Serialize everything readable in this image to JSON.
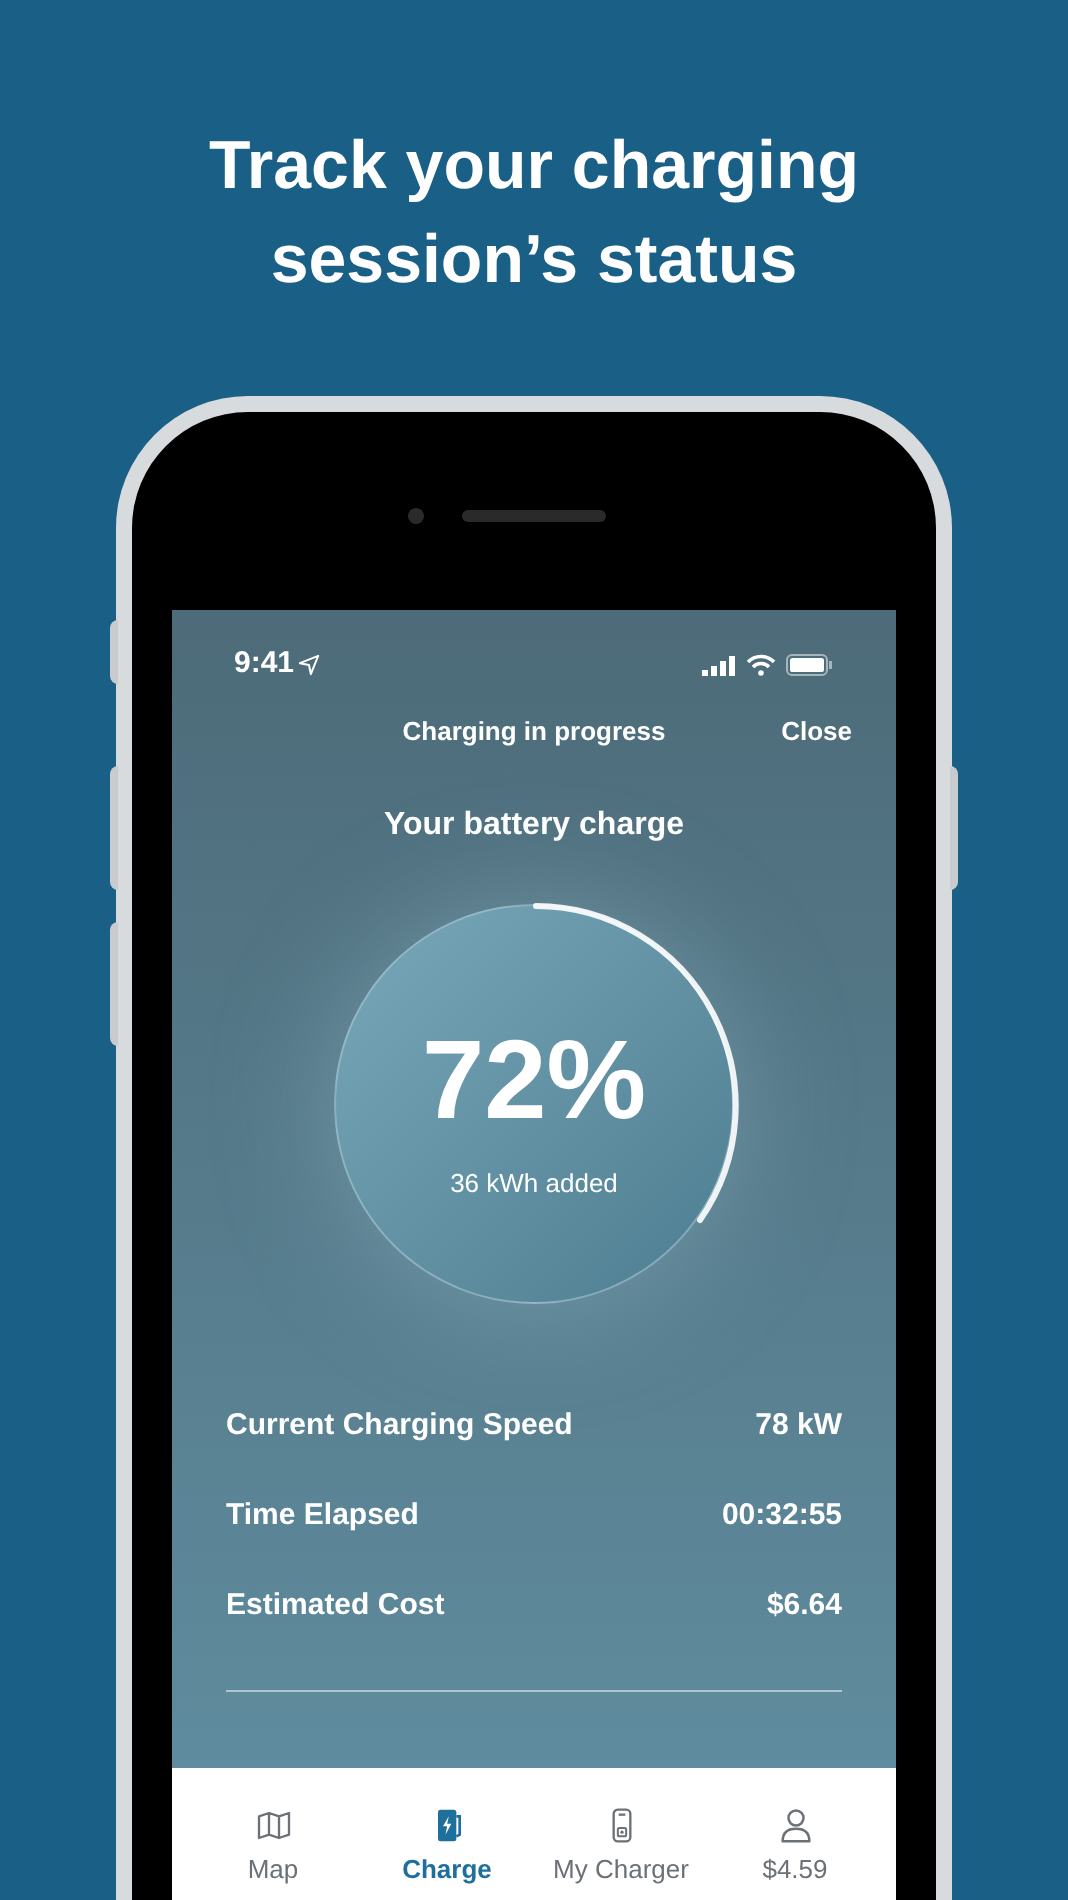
{
  "headline": "Track your charging session’s status",
  "status_bar": {
    "time": "9:41"
  },
  "header": {
    "title": "Charging in progress",
    "close": "Close"
  },
  "battery": {
    "heading": "Your battery charge",
    "percent": "72%",
    "added": "36 kWh added"
  },
  "stats": [
    {
      "label": "Current Charging Speed",
      "value": "78 kW"
    },
    {
      "label": "Time Elapsed",
      "value": "00:32:55"
    },
    {
      "label": "Estimated Cost",
      "value": "$6.64"
    }
  ],
  "tab_bar": [
    {
      "label": "Map",
      "selected": false
    },
    {
      "label": "Charge",
      "selected": true
    },
    {
      "label": "My Charger",
      "selected": false
    },
    {
      "label": "$4.59",
      "selected": false
    }
  ]
}
